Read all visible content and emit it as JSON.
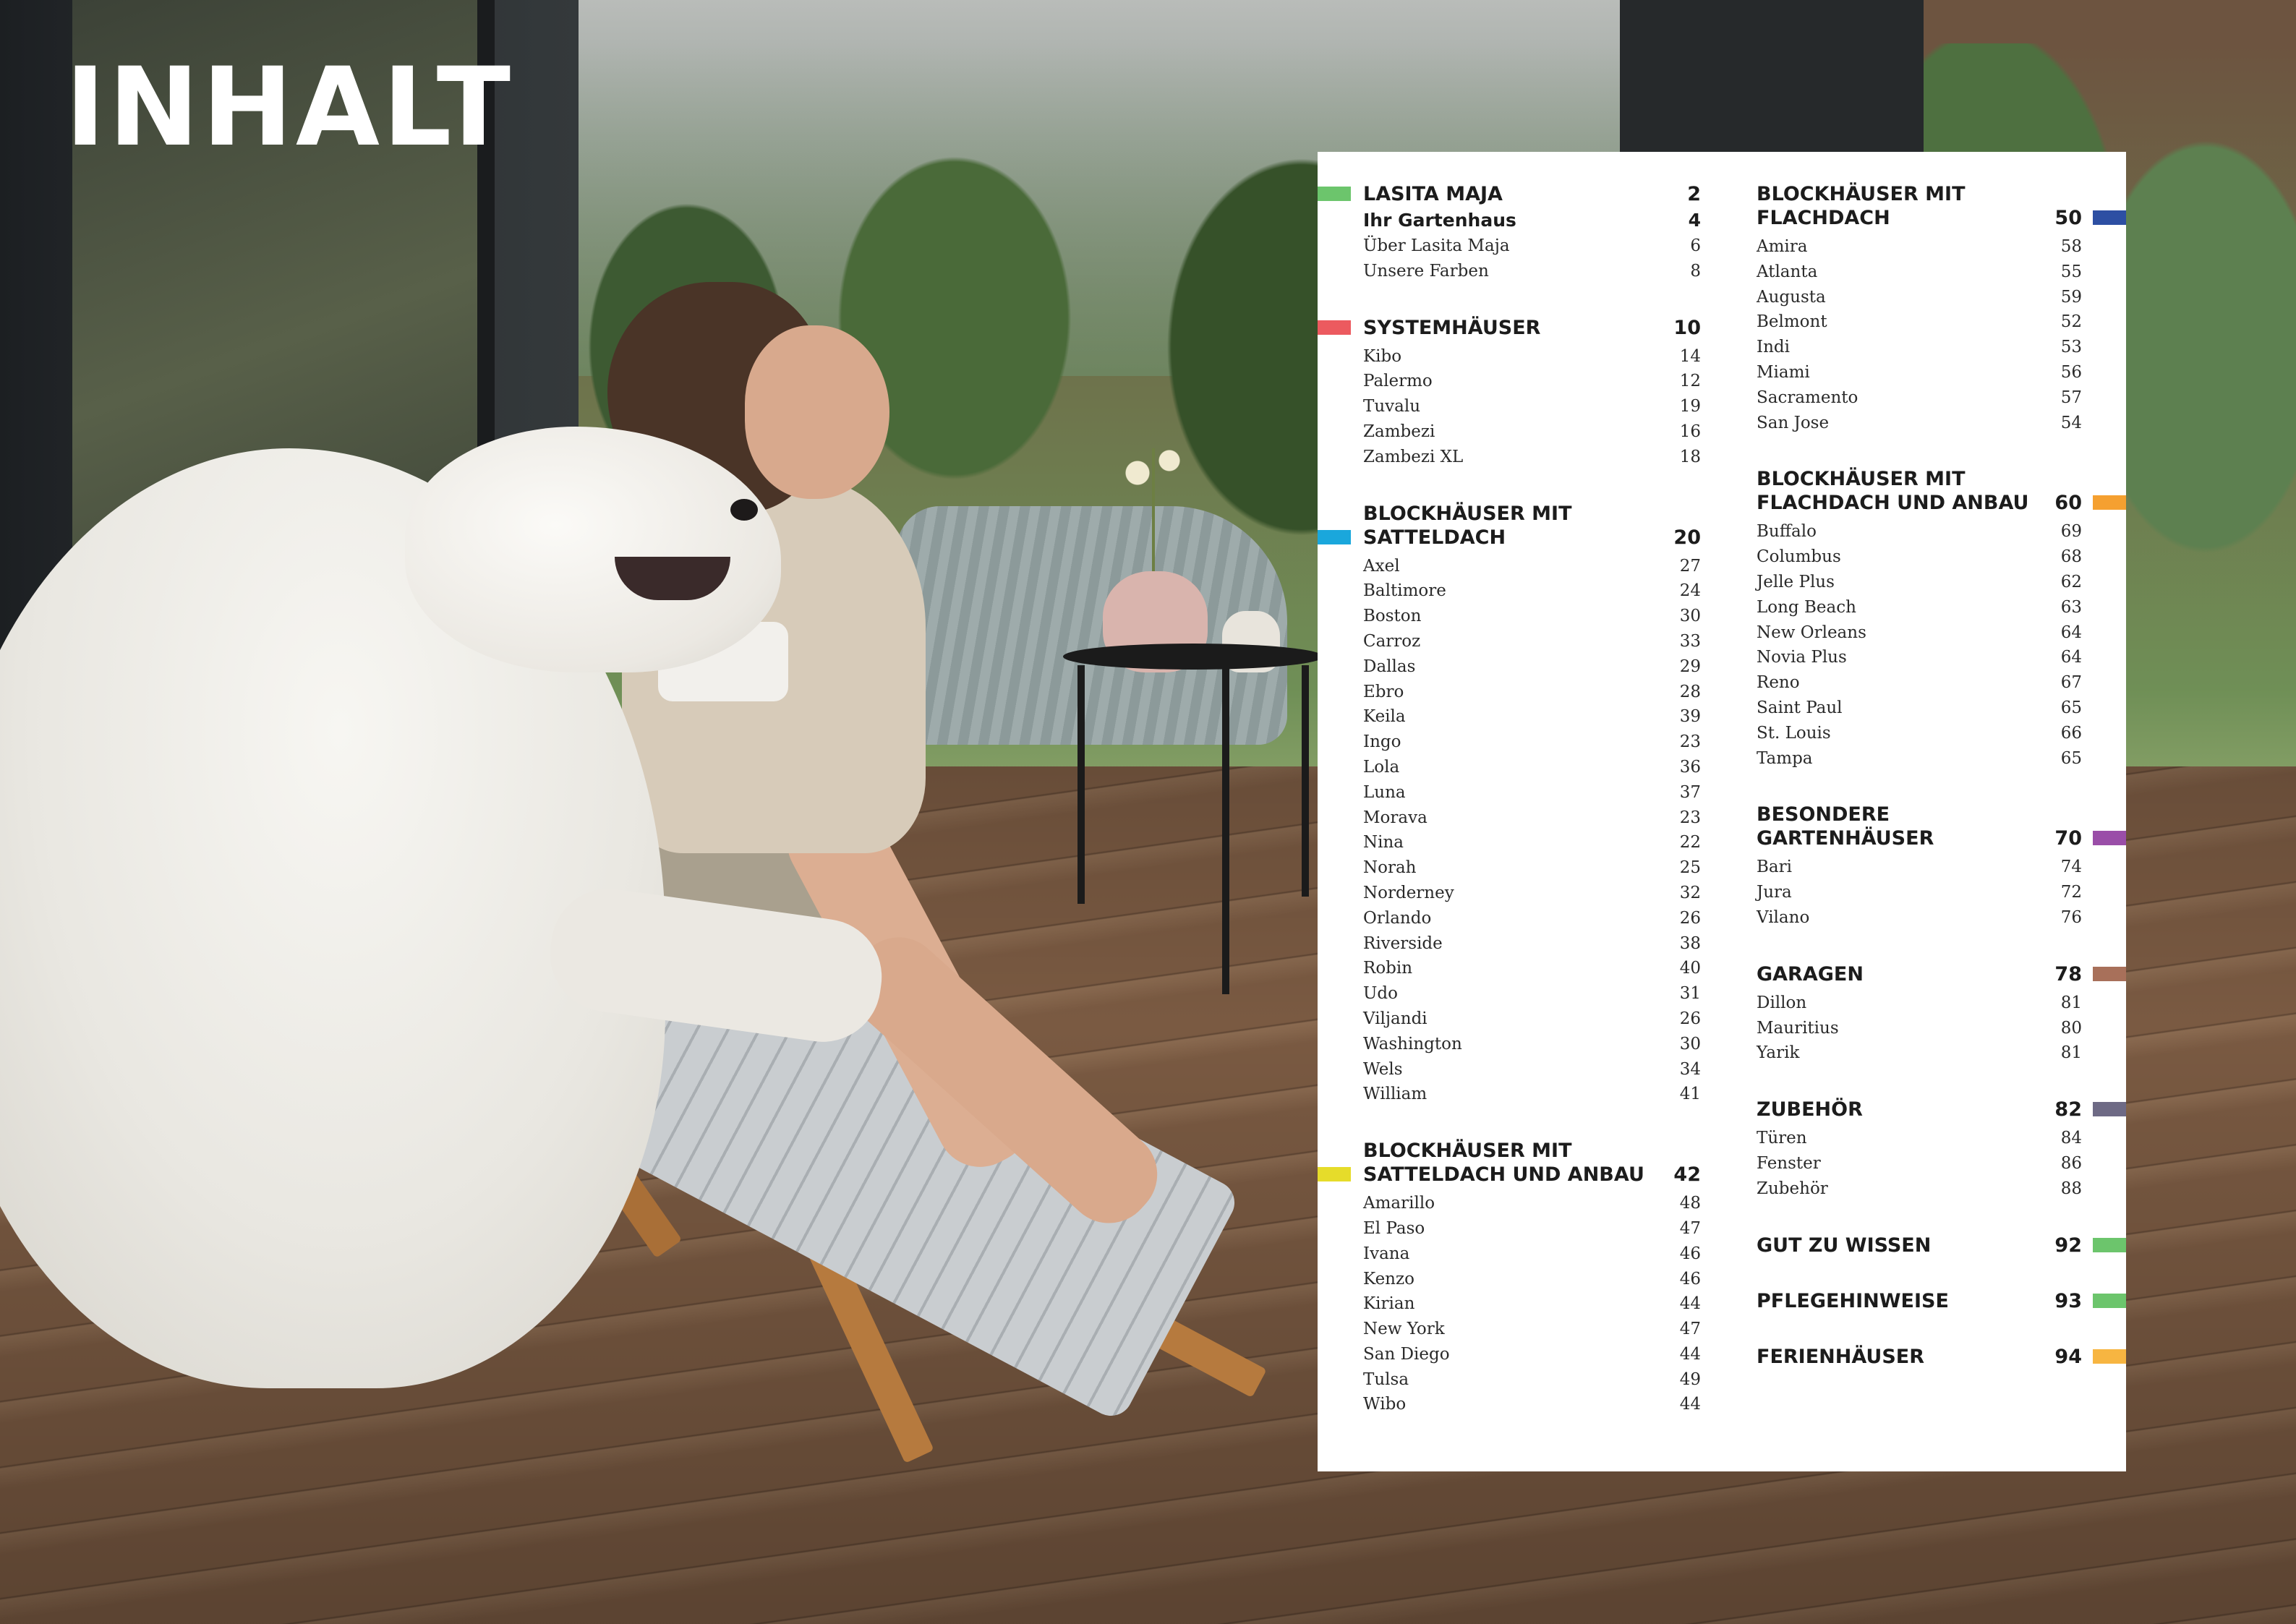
{
  "page": {
    "title": "INHALT"
  },
  "toc": {
    "left": [
      {
        "key": "lasita-maja",
        "title": "LASITA MAJA",
        "page": "2",
        "color": "#6cc56c",
        "sub": {
          "label": "Ihr Gartenhaus",
          "page": "4"
        },
        "items": [
          {
            "label": "Über Lasita Maja",
            "page": "6"
          },
          {
            "label": "Unsere Farben",
            "page": "8"
          }
        ]
      },
      {
        "key": "systemhaeuser",
        "title": "SYSTEMHÄUSER",
        "page": "10",
        "color": "#ec5a5f",
        "items": [
          {
            "label": "Kibo",
            "page": "14"
          },
          {
            "label": "Palermo",
            "page": "12"
          },
          {
            "label": "Tuvalu",
            "page": "19"
          },
          {
            "label": "Zambezi",
            "page": "16"
          },
          {
            "label": "Zambezi XL",
            "page": "18"
          }
        ]
      },
      {
        "key": "satteldach",
        "title": "BLOCKHÄUSER MIT\nSATTELDACH",
        "page": "20",
        "color": "#1aa7dc",
        "items": [
          {
            "label": "Axel",
            "page": "27"
          },
          {
            "label": "Baltimore",
            "page": "24"
          },
          {
            "label": "Boston",
            "page": "30"
          },
          {
            "label": "Carroz",
            "page": "33"
          },
          {
            "label": "Dallas",
            "page": "29"
          },
          {
            "label": "Ebro",
            "page": "28"
          },
          {
            "label": "Keila",
            "page": "39"
          },
          {
            "label": "Ingo",
            "page": "23"
          },
          {
            "label": "Lola",
            "page": "36"
          },
          {
            "label": "Luna",
            "page": "37"
          },
          {
            "label": "Morava",
            "page": "23"
          },
          {
            "label": "Nina",
            "page": "22"
          },
          {
            "label": "Norah",
            "page": "25"
          },
          {
            "label": "Norderney",
            "page": "32"
          },
          {
            "label": "Orlando",
            "page": "26"
          },
          {
            "label": "Riverside",
            "page": "38"
          },
          {
            "label": "Robin",
            "page": "40"
          },
          {
            "label": "Udo",
            "page": "31"
          },
          {
            "label": "Viljandi",
            "page": "26"
          },
          {
            "label": "Washington",
            "page": "30"
          },
          {
            "label": "Wels",
            "page": "34"
          },
          {
            "label": "William",
            "page": "41"
          }
        ]
      },
      {
        "key": "satteldach-anbau",
        "title": "BLOCKHÄUSER MIT\nSATTELDACH UND ANBAU",
        "page": "42",
        "color": "#e6dc2a",
        "items": [
          {
            "label": "Amarillo",
            "page": "48"
          },
          {
            "label": "El Paso",
            "page": "47"
          },
          {
            "label": "Ivana",
            "page": "46"
          },
          {
            "label": "Kenzo",
            "page": "46"
          },
          {
            "label": "Kirian",
            "page": "44"
          },
          {
            "label": "New York",
            "page": "47"
          },
          {
            "label": "San Diego",
            "page": "44"
          },
          {
            "label": "Tulsa",
            "page": "49"
          },
          {
            "label": "Wibo",
            "page": "44"
          }
        ]
      }
    ],
    "right": [
      {
        "key": "flachdach",
        "title": "BLOCKHÄUSER MIT\nFLACHDACH",
        "page": "50",
        "color": "#2d4fa3",
        "items": [
          {
            "label": "Amira",
            "page": "58"
          },
          {
            "label": "Atlanta",
            "page": "55"
          },
          {
            "label": "Augusta",
            "page": "59"
          },
          {
            "label": "Belmont",
            "page": "52"
          },
          {
            "label": "Indi",
            "page": "53"
          },
          {
            "label": "Miami",
            "page": "56"
          },
          {
            "label": "Sacramento",
            "page": "57"
          },
          {
            "label": "San Jose",
            "page": "54"
          }
        ]
      },
      {
        "key": "flachdach-anbau",
        "title": "BLOCKHÄUSER MIT\nFLACHDACH UND ANBAU",
        "page": "60",
        "color": "#f5a030",
        "items": [
          {
            "label": "Buffalo",
            "page": "69"
          },
          {
            "label": "Columbus",
            "page": "68"
          },
          {
            "label": "Jelle Plus",
            "page": "62"
          },
          {
            "label": "Long Beach",
            "page": "63"
          },
          {
            "label": "New Orleans",
            "page": "64"
          },
          {
            "label": "Novia Plus",
            "page": "64"
          },
          {
            "label": "Reno",
            "page": "67"
          },
          {
            "label": "Saint Paul",
            "page": "65"
          },
          {
            "label": "St. Louis",
            "page": "66"
          },
          {
            "label": "Tampa",
            "page": "65"
          }
        ]
      },
      {
        "key": "besondere",
        "title": "BESONDERE\nGARTENHÄUSER",
        "page": "70",
        "color": "#9a4ea8",
        "items": [
          {
            "label": "Bari",
            "page": "74"
          },
          {
            "label": "Jura",
            "page": "72"
          },
          {
            "label": "Vilano",
            "page": "76"
          }
        ]
      },
      {
        "key": "garagen",
        "title": "GARAGEN",
        "page": "78",
        "color": "#a8705a",
        "items": [
          {
            "label": "Dillon",
            "page": "81"
          },
          {
            "label": "Mauritius",
            "page": "80"
          },
          {
            "label": "Yarik",
            "page": "81"
          }
        ]
      },
      {
        "key": "zubehoer",
        "title": "ZUBEHÖR",
        "page": "82",
        "color": "#6e6a85",
        "items": [
          {
            "label": "Türen",
            "page": "84"
          },
          {
            "label": "Fenster",
            "page": "86"
          },
          {
            "label": "Zubehör",
            "page": "88"
          }
        ]
      },
      {
        "key": "gut",
        "title": "GUT ZU WISSEN",
        "page": "92",
        "color": "#6cc56c",
        "items": []
      },
      {
        "key": "pflege",
        "title": "PFLEGEHINWEISE",
        "page": "93",
        "color": "#6cc56c",
        "items": []
      },
      {
        "key": "ferien",
        "title": "FERIENHÄUSER",
        "page": "94",
        "color": "#f7b541",
        "items": []
      }
    ]
  }
}
